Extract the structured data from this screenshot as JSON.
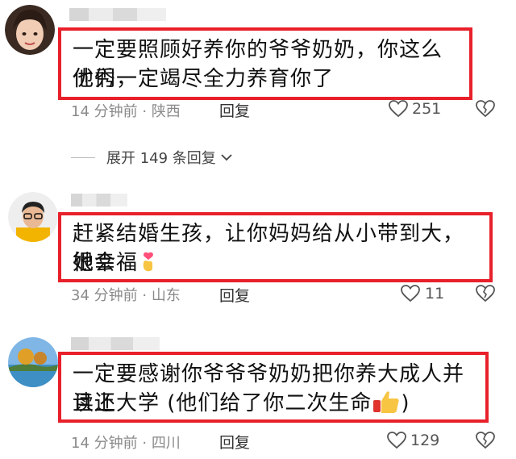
{
  "comments": [
    {
      "text_line1": "一定要照顾好养你的爷爷奶奶，你这么优秀，",
      "text_line2": "他们一定竭尽全力养育你了",
      "time": "14 分钟前",
      "location": "陕西",
      "reply_label": "回复",
      "likes": "251"
    },
    {
      "text_line1": "赶紧结婚生孩，让你妈妈给从小带到大，她会",
      "text_line2": "很幸福",
      "time": "34 分钟前",
      "location": "山东",
      "reply_label": "回复",
      "likes": "11"
    },
    {
      "text_line1": "一定要感谢你爷爷爷奶奶把你养大成人并且还",
      "text_line2": "读上大学 (他们给了你二次生命",
      "time": "14 分钟前",
      "location": "四川",
      "reply_label": "回复",
      "likes": "129"
    }
  ],
  "expand_replies": "展开 149 条回复",
  "colors": {
    "highlight_border": "#e8202a",
    "meta_gray": "#8a8a8a"
  },
  "icons": [
    "heart-outline-icon",
    "broken-heart-icon",
    "chevron-down-icon",
    "finger-heart-emoji-icon",
    "thumbs-up-emoji-icon"
  ]
}
